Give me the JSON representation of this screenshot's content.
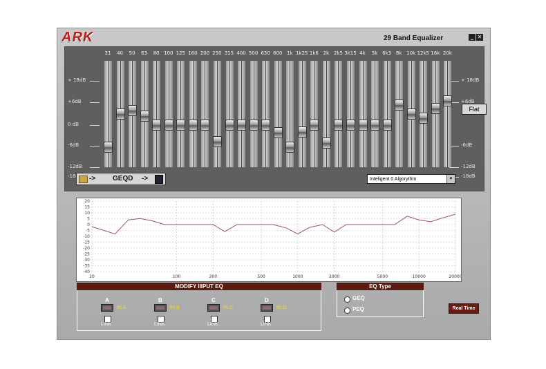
{
  "window": {
    "logo": "ARK",
    "title": "29 Band Equalizer",
    "minimize_icon": "minimize-icon",
    "close_icon": "close-icon"
  },
  "scale": {
    "left": [
      "+ 18dB",
      "+6dB",
      "0 dB",
      "-6dB",
      "-12dB",
      "-18dB"
    ],
    "right": [
      "+ 18dB",
      "+6dB",
      "-6dB",
      "-12dB",
      "-18dB"
    ]
  },
  "bands": [
    {
      "freq": "31",
      "gain": -2
    },
    {
      "freq": "40",
      "gain": 1
    },
    {
      "freq": "50",
      "gain": 1.3
    },
    {
      "freq": "63",
      "gain": 0.8
    },
    {
      "freq": "80",
      "gain": 0
    },
    {
      "freq": "100",
      "gain": 0
    },
    {
      "freq": "125",
      "gain": 0
    },
    {
      "freq": "160",
      "gain": 0
    },
    {
      "freq": "200",
      "gain": 0
    },
    {
      "freq": "250",
      "gain": -1.5
    },
    {
      "freq": "315",
      "gain": 0
    },
    {
      "freq": "400",
      "gain": 0
    },
    {
      "freq": "500",
      "gain": 0
    },
    {
      "freq": "630",
      "gain": 0
    },
    {
      "freq": "800",
      "gain": -0.7
    },
    {
      "freq": "1k",
      "gain": -2
    },
    {
      "freq": "1k25",
      "gain": -0.6
    },
    {
      "freq": "1k6",
      "gain": 0
    },
    {
      "freq": "2k",
      "gain": -1.6
    },
    {
      "freq": "2k5",
      "gain": 0
    },
    {
      "freq": "3k15",
      "gain": 0
    },
    {
      "freq": "4k",
      "gain": 0
    },
    {
      "freq": "5k",
      "gain": 0
    },
    {
      "freq": "6k3",
      "gain": 0
    },
    {
      "freq": "8k",
      "gain": 1.8
    },
    {
      "freq": "10k",
      "gain": 1
    },
    {
      "freq": "12k5",
      "gain": 0.6
    },
    {
      "freq": "16k",
      "gain": 1.5
    },
    {
      "freq": "20k",
      "gain": 2.2
    }
  ],
  "flat_button": "Flat",
  "preset": {
    "name": "GEQD",
    "arrow1": "->",
    "arrow2": "->",
    "open_icon": "folder-open-icon",
    "save_icon": "save-disk-icon"
  },
  "algorithm": {
    "selected": "Inteligent 0 Algorythm"
  },
  "graph": {
    "y_labels": [
      "20",
      "15",
      "10",
      "5",
      "0",
      "-5",
      "-10",
      "-15",
      "-20",
      "-25",
      "-30",
      "-35",
      "-40"
    ],
    "x_labels": [
      "20",
      "100",
      "200",
      "500",
      "1000",
      "2000",
      "5000",
      "10000",
      "20000"
    ],
    "curve_color": "#9a4a7a"
  },
  "modify": {
    "title": "MODIFY IIIPUT EQ",
    "channels": [
      {
        "label": "A",
        "input": "IN A",
        "link": "LINK"
      },
      {
        "label": "B",
        "input": "IN B",
        "link": "LINK"
      },
      {
        "label": "C",
        "input": "IN C",
        "link": "LINK"
      },
      {
        "label": "D",
        "input": "IN D",
        "link": "LINK"
      }
    ]
  },
  "eq_type": {
    "title": "EQ Type",
    "options": [
      "GEQ",
      "PEQ"
    ],
    "selected": "GEQ"
  },
  "real_time": "Real Time"
}
